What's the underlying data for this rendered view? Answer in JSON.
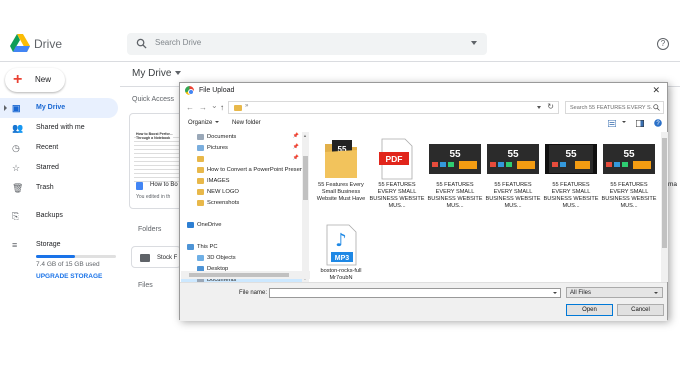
{
  "drive": {
    "app_name": "Drive",
    "search_placeholder": "Search Drive",
    "help_glyph": "?",
    "new_label": "New",
    "new_glyph": "+",
    "sidebar": [
      {
        "label": "My Drive",
        "icon": "drive-icon",
        "glyph": "▣",
        "active": true
      },
      {
        "label": "Shared with me",
        "icon": "people-icon",
        "glyph": "👥"
      },
      {
        "label": "Recent",
        "icon": "clock-icon",
        "glyph": "◷"
      },
      {
        "label": "Starred",
        "icon": "star-icon",
        "glyph": "☆"
      },
      {
        "label": "Trash",
        "icon": "trash-icon",
        "glyph": "🗑"
      },
      {
        "label": "Backups",
        "icon": "backup-icon",
        "glyph": "⎘"
      },
      {
        "label": "Storage",
        "icon": "storage-icon",
        "glyph": "≡"
      }
    ],
    "storage_used": "7.4 GB of 15 GB used",
    "storage_fraction": 0.49,
    "upgrade_label": "UPGRADE STORAGE",
    "breadcrumb": "My Drive",
    "quick_access": "Quick Access",
    "quick_card": {
      "thumb_title": "How to Boost Perfor...\nThrough a Notebook",
      "title": "How to Bo",
      "subtitle": "You edited in th"
    },
    "folders_heading": "Folders",
    "folder_card": "Stock F",
    "files_heading": "Files",
    "right_fragment": "ma"
  },
  "dialog": {
    "title": "File Upload",
    "close_glyph": "✕",
    "nav": {
      "back": "←",
      "forward": "→",
      "recent": "⌄",
      "up": "↑",
      "address_chevron": "»",
      "refresh": "↻"
    },
    "search_placeholder": "Search 55 FEATURES EVERY S...",
    "organize_label": "Organize",
    "new_folder_label": "New folder",
    "tree": [
      {
        "label": "Documents",
        "icon": "documents-icon",
        "color": "#9aa8b8",
        "indent": 1,
        "pinned": true
      },
      {
        "label": "Pictures",
        "icon": "pictures-icon",
        "color": "#7aaede",
        "indent": 1,
        "pinned": true
      },
      {
        "label": "",
        "icon": "folder-icon",
        "color": "#e8b84a",
        "indent": 1,
        "pinned": true
      },
      {
        "label": "How to Convert a PowerPoint Present",
        "icon": "folder-icon",
        "color": "#e8b84a",
        "indent": 1
      },
      {
        "label": "IMAGES",
        "icon": "folder-icon",
        "color": "#e8b84a",
        "indent": 1
      },
      {
        "label": "NEW LOGO",
        "icon": "folder-icon",
        "color": "#e8b84a",
        "indent": 1
      },
      {
        "label": "Screenshots",
        "icon": "folder-icon",
        "color": "#e8b84a",
        "indent": 1
      },
      {
        "label": "",
        "icon": "spacer",
        "color": "",
        "indent": 0
      },
      {
        "label": "OneDrive",
        "icon": "onedrive-icon",
        "color": "#2d7fd3",
        "indent": 0
      },
      {
        "label": "",
        "icon": "spacer",
        "color": "",
        "indent": 0
      },
      {
        "label": "This PC",
        "icon": "pc-icon",
        "color": "#4d94d6",
        "indent": 0
      },
      {
        "label": "3D Objects",
        "icon": "3d-objects-icon",
        "color": "#6fb0e6",
        "indent": 1
      },
      {
        "label": "Desktop",
        "icon": "desktop-icon",
        "color": "#4d94d6",
        "indent": 1
      },
      {
        "label": "Documents",
        "icon": "documents-icon",
        "color": "#9aa8b8",
        "indent": 1,
        "selected": true
      }
    ],
    "pin_glyph": "📌",
    "files": [
      {
        "name": "55 Features Every Small Business Website Must Have",
        "type": "folder-file-icon"
      },
      {
        "name": "55 FEATURES EVERY SMALL BUSINESS WEBSITE MUS...",
        "type": "pdf-icon",
        "badge": "PDF"
      },
      {
        "name": "55 FEATURES EVERY SMALL BUSINESS WEBSITE MUS...",
        "type": "image-thumbnail-icon",
        "badge": "55"
      },
      {
        "name": "55 FEATURES EVERY SMALL BUSINESS WEBSITE MUS...",
        "type": "image-thumbnail-icon",
        "badge": "55"
      },
      {
        "name": "55 FEATURES EVERY SMALL BUSINESS WEBSITE MUS...",
        "type": "video-thumbnail-icon",
        "badge": "55"
      },
      {
        "name": "55 FEATURES EVERY SMALL BUSINESS WEBSITE MUS...",
        "type": "image-thumbnail-icon",
        "badge": "55"
      },
      {
        "name": "boston-rocks-full Mr7oubN",
        "type": "mp3-icon",
        "badge": "MP3"
      }
    ],
    "file_name_label": "File name:",
    "file_name_value": "",
    "file_type": "All Files",
    "open_label": "Open",
    "cancel_label": "Cancel"
  }
}
